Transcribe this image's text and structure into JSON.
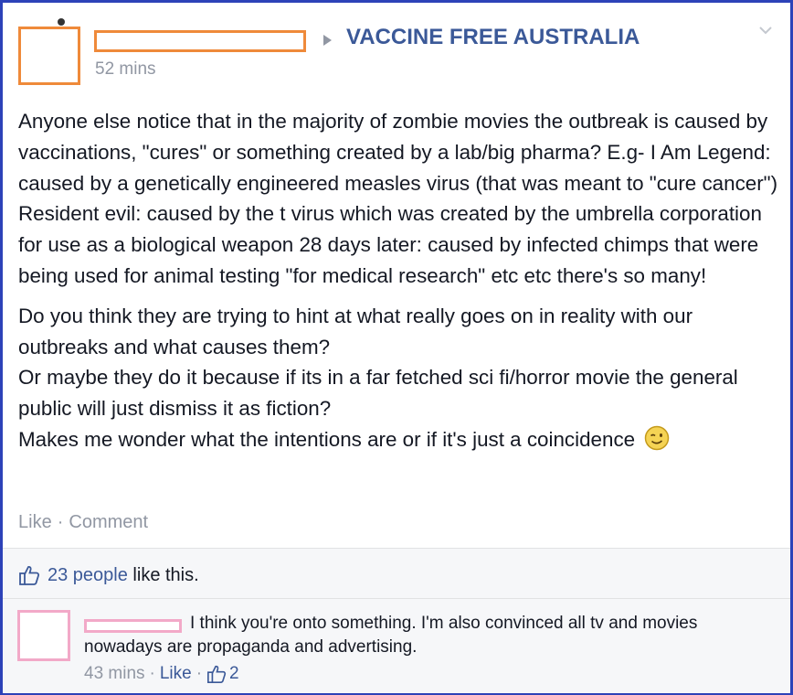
{
  "post": {
    "group_name": "VACCINE FREE AUSTRALIA",
    "time": "52 mins",
    "paragraph1": "Anyone else notice that in the majority of zombie movies the outbreak is caused by vaccinations, \"cures\" or something created by a lab/big pharma? E.g- I Am Legend: caused by a genetically engineered measles virus (that was meant to \"cure cancer\") Resident evil: caused by the t virus which was created by the umbrella corporation for use as a biological weapon 28 days later: caused by infected chimps that were being used for animal testing \"for medical research\" etc etc there's so many!",
    "line2a": "Do you think they are trying to hint at what really goes on in reality with our outbreaks and what causes them?",
    "line2b": "Or maybe they do it because if its in a far fetched sci fi/horror movie the general public will just dismiss it as fiction?",
    "line2c": "Makes me wonder what the intentions are or if it's just a coincidence",
    "emoji": "wink-smiley-icon"
  },
  "actions": {
    "like": "Like",
    "comment": "Comment",
    "separator": "·"
  },
  "likes": {
    "count_text": "23 people",
    "suffix": " like this."
  },
  "comment": {
    "text": "I think you're onto something. I'm also convinced all tv and movies nowadays are propaganda and advertising.",
    "time": "43 mins",
    "like": "Like",
    "like_count": "2",
    "separator": "·"
  },
  "colors": {
    "border": "#2d42b8",
    "link": "#3b5998",
    "meta": "#9197a3",
    "redact_main": "#ef8a3a",
    "redact_comment": "#f2a9c8"
  }
}
